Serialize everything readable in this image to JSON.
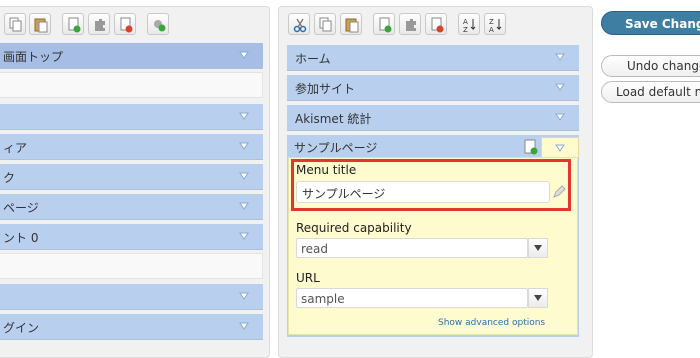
{
  "left_panel": {
    "items": [
      {
        "label": "画面トップ"
      },
      {
        "label": ""
      },
      {
        "label": ""
      },
      {
        "label": "ィア"
      },
      {
        "label": "ク"
      },
      {
        "label": "ページ"
      },
      {
        "label": "ント 0"
      },
      {
        "label": ""
      },
      {
        "label": ""
      },
      {
        "label": "グイン"
      }
    ]
  },
  "right_panel": {
    "items": [
      {
        "label": "ホーム"
      },
      {
        "label": "参加サイト"
      },
      {
        "label": "Akismet 統計"
      }
    ],
    "expanded": {
      "title": "サンプルページ",
      "menu_title_label": "Menu title",
      "menu_title_value": "サンプルページ",
      "capability_label": "Required capability",
      "capability_value": "read",
      "url_label": "URL",
      "url_value": "sample",
      "advanced_link": "Show advanced options"
    }
  },
  "side_actions": {
    "save": "Save Changes",
    "undo": "Undo changes",
    "load_default": "Load default menu"
  },
  "colors": {
    "menu_item_bg": "#b9cfee",
    "edit_box_bg": "#fefbcf",
    "highlight_border": "#e0382c",
    "save_button": "#3f7ea3"
  }
}
